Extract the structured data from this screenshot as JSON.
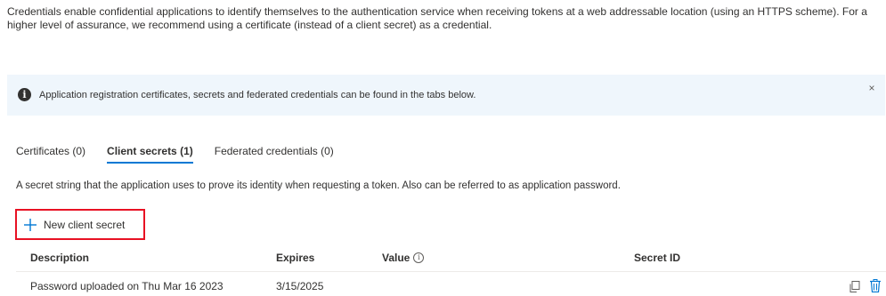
{
  "intro": {
    "text": "Credentials enable confidential applications to identify themselves to the authentication service when receiving tokens at a web addressable location (using an HTTPS scheme). For a higher level of assurance, we recommend using a certificate (instead of a client secret) as a credential."
  },
  "info_banner": {
    "icon": "info-icon",
    "text": "Application registration certificates, secrets and federated credentials can be found in the tabs below.",
    "close_glyph": "×"
  },
  "tabs": [
    {
      "label": "Certificates (0)",
      "active": false
    },
    {
      "label": "Client secrets (1)",
      "active": true
    },
    {
      "label": "Federated credentials (0)",
      "active": false
    }
  ],
  "tab_description": "A secret string that the application uses to prove its identity when requesting a token. Also can be referred to as application password.",
  "new_secret_button": {
    "label": "New client secret",
    "icon": "plus-icon"
  },
  "table": {
    "headers": {
      "description": "Description",
      "expires": "Expires",
      "value": "Value",
      "secret_id": "Secret ID"
    },
    "rows": [
      {
        "description": "Password uploaded on Thu Mar 16 2023",
        "expires": "3/15/2025",
        "value": "",
        "secret_id": ""
      }
    ]
  },
  "colors": {
    "accent": "#0078d4",
    "highlight_border": "#e81123",
    "banner_bg": "#eff6fc"
  }
}
